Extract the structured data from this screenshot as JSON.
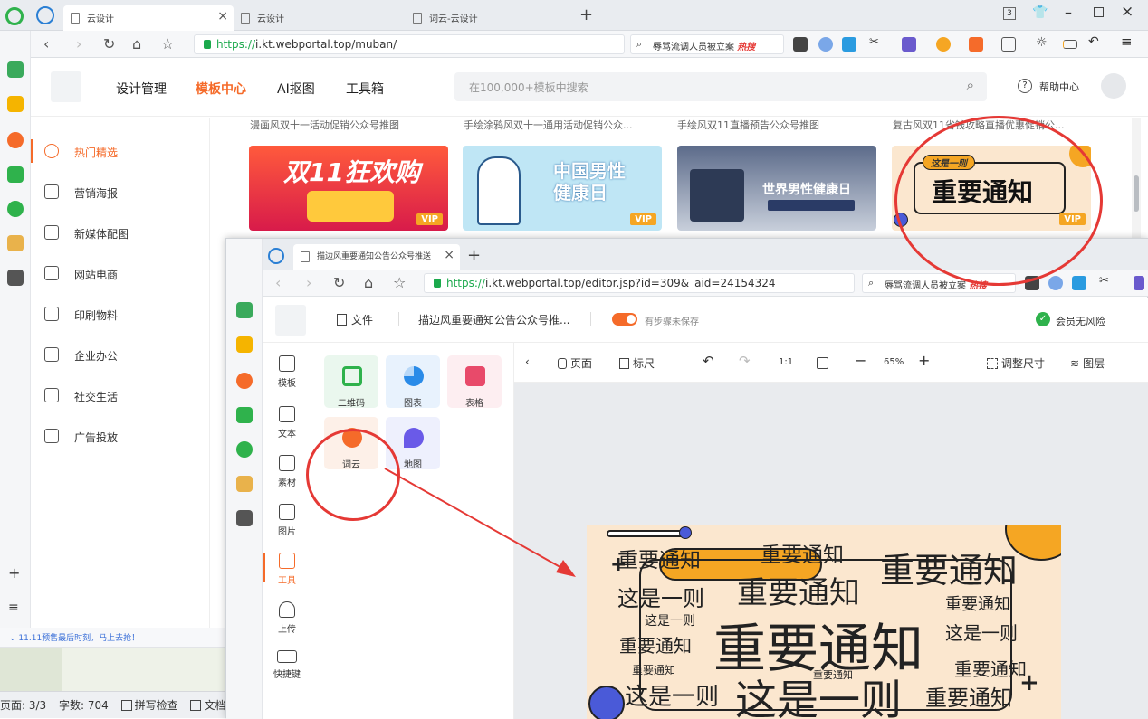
{
  "outer_browser": {
    "tabs": [
      {
        "label": "云设计",
        "active": true
      },
      {
        "label": "云设计",
        "active": false
      },
      {
        "label": "词云-云设计",
        "active": false
      }
    ],
    "tab_counter": "3",
    "url_https": "https://",
    "url_rest": "i.kt.webportal.top/muban/",
    "search_text": "辱骂流调人员被立案",
    "hot_label": "热搜"
  },
  "site": {
    "nav": [
      "设计管理",
      "模板中心",
      "AI抠图",
      "工具箱"
    ],
    "search_placeholder": "在100,000+模板中搜索",
    "help": "帮助中心",
    "sidebar": [
      "热门精选",
      "营销海报",
      "新媒体配图",
      "网站电商",
      "印刷物料",
      "企业办公",
      "社交生活",
      "广告投放"
    ],
    "templates": [
      {
        "caption": "漫画风双十一活动促销公众号推图",
        "title": "双11狂欢购",
        "badge": "VIP"
      },
      {
        "caption": "手绘涂鸦风双十一通用活动促销公众...",
        "title": "中国男性健康日",
        "badge": "VIP"
      },
      {
        "caption": "手绘风双11直播预告公众号推图",
        "title": "世界男性健康日",
        "badge": ""
      },
      {
        "caption": "复古风双11省钱攻略直播优惠促销公...",
        "title": "重要通知",
        "tag": "这是一则",
        "badge": "VIP"
      }
    ]
  },
  "doc": {
    "promo": "11.11预售最后时刻，马上去抢！",
    "page": "页面: 3/3",
    "words": "字数: 704",
    "spell": "拼写检查",
    "doc_label": "文档"
  },
  "inner_browser": {
    "tab_label": "描边风重要通知公告公众号推送",
    "url_https": "https://",
    "url_rest": "i.kt.webportal.top/editor.jsp?id=309&_aid=24154324",
    "search_text": "辱骂流调人员被立案",
    "hot_label": "热搜"
  },
  "editor": {
    "file_menu": "文件",
    "doc_title": "描边风重要通知公告公众号推...",
    "save_status": "有步骤未保存",
    "risk_label": "会员无风险",
    "tools": [
      "模板",
      "文本",
      "素材",
      "图片",
      "工具",
      "上传",
      "快捷键"
    ],
    "widgets": [
      "二维码",
      "图表",
      "表格",
      "词云",
      "地图"
    ],
    "toolbar": {
      "page": "页面",
      "ruler": "标尺",
      "ratio": "1:1",
      "zoom": "65%",
      "resize": "调整尺寸",
      "layers": "图层"
    }
  },
  "wordcloud": {
    "words": [
      "重要通知",
      "这是一则"
    ]
  },
  "colors": {
    "accent": "#f56b2a",
    "annotation": "#e53935",
    "wordcloud_bg": "#fbe7cf"
  }
}
